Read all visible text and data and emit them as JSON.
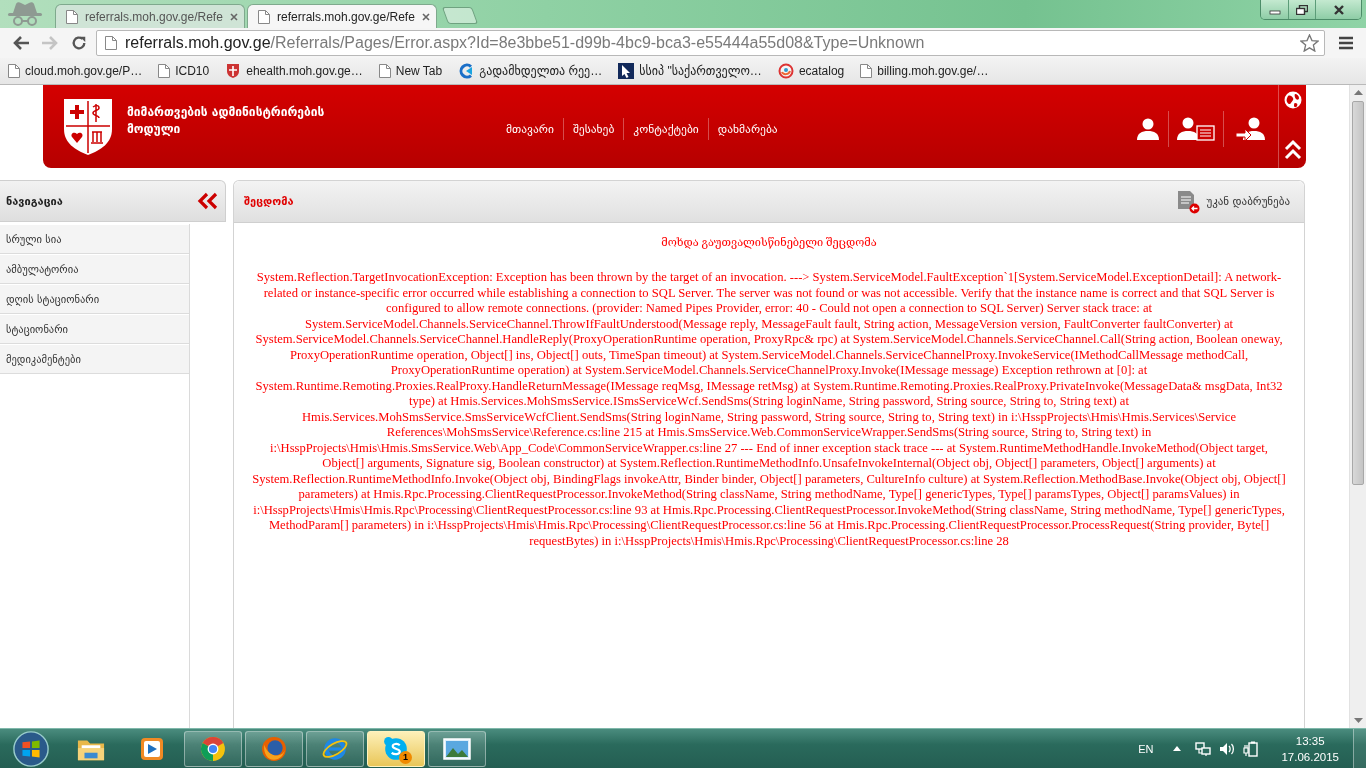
{
  "browser": {
    "tabs": [
      {
        "title": "referrals.moh.gov.ge/Refe",
        "selected": false
      },
      {
        "title": "referrals.moh.gov.ge/Refe",
        "selected": true
      }
    ],
    "back_enabled": true,
    "forward_enabled": false,
    "address": {
      "host": "referrals.moh.gov.ge",
      "path": "/Referrals/Pages/Error.aspx?Id=8e3bbe51-d99b-4bc9-bca3-e55444a55d08&Type=Unknown"
    },
    "bookmarks": [
      {
        "label": "cloud.moh.gov.ge/P…",
        "kind": "page"
      },
      {
        "label": "ICD10",
        "kind": "page"
      },
      {
        "label": "ehealth.moh.gov.ge…",
        "kind": "emblem"
      },
      {
        "label": "New Tab",
        "kind": "page"
      },
      {
        "label": "გადამხდელთა რეე…",
        "kind": "ring"
      },
      {
        "label": "სსიპ \"საქართველო…",
        "kind": "cursor"
      },
      {
        "label": "ecatalog",
        "kind": "swirl"
      },
      {
        "label": "billing.moh.gov.ge/…",
        "kind": "page"
      }
    ]
  },
  "header": {
    "title": "მიმართვების ადმინისტრირების მოდული",
    "nav": [
      "მთავარი",
      "შესახებ",
      "კონტაქტები",
      "დახმარება"
    ]
  },
  "sidebar": {
    "title": "ნავიგაცია",
    "items": [
      "სრული სია",
      "ამბულატორია",
      "დღის სტაციონარი",
      "სტაციონარი",
      "მედიკამენტები"
    ]
  },
  "panel": {
    "title": "შეცდომა",
    "back_button": "უკან დაბრუნება",
    "message": "მოხდა გაუთვალისწინებელი შეცდომა",
    "error_details": "System.Reflection.TargetInvocationException: Exception has been thrown by the target of an invocation. ---> System.ServiceModel.FaultException`1[System.ServiceModel.ExceptionDetail]: A network-related or instance-specific error occurred while establishing a connection to SQL Server. The server was not found or was not accessible. Verify that the instance name is correct and that SQL Server is configured to allow remote connections. (provider: Named Pipes Provider, error: 40 - Could not open a connection to SQL Server) Server stack trace: at System.ServiceModel.Channels.ServiceChannel.ThrowIfFaultUnderstood(Message reply, MessageFault fault, String action, MessageVersion version, FaultConverter faultConverter) at System.ServiceModel.Channels.ServiceChannel.HandleReply(ProxyOperationRuntime operation, ProxyRpc& rpc) at System.ServiceModel.Channels.ServiceChannel.Call(String action, Boolean oneway, ProxyOperationRuntime operation, Object[] ins, Object[] outs, TimeSpan timeout) at System.ServiceModel.Channels.ServiceChannelProxy.InvokeService(IMethodCallMessage methodCall, ProxyOperationRuntime operation) at System.ServiceModel.Channels.ServiceChannelProxy.Invoke(IMessage message) Exception rethrown at [0]: at System.Runtime.Remoting.Proxies.RealProxy.HandleReturnMessage(IMessage reqMsg, IMessage retMsg) at System.Runtime.Remoting.Proxies.RealProxy.PrivateInvoke(MessageData& msgData, Int32 type) at Hmis.Services.MohSmsService.ISmsServiceWcf.SendSms(String loginName, String password, String source, String to, String text) at Hmis.Services.MohSmsService.SmsServiceWcfClient.SendSms(String loginName, String password, String source, String to, String text) in i:\\HsspProjects\\Hmis\\Hmis.Services\\Service References\\MohSmsService\\Reference.cs:line 215 at Hmis.SmsService.Web.CommonServiceWrapper.SendSms(String source, String to, String text) in i:\\HsspProjects\\Hmis\\Hmis.SmsService.Web\\App_Code\\CommonServiceWrapper.cs:line 27 --- End of inner exception stack trace --- at System.RuntimeMethodHandle.InvokeMethod(Object target, Object[] arguments, Signature sig, Boolean constructor) at System.Reflection.RuntimeMethodInfo.UnsafeInvokeInternal(Object obj, Object[] parameters, Object[] arguments) at System.Reflection.RuntimeMethodInfo.Invoke(Object obj, BindingFlags invokeAttr, Binder binder, Object[] parameters, CultureInfo culture) at System.Reflection.MethodBase.Invoke(Object obj, Object[] parameters) at Hmis.Rpc.Processing.ClientRequestProcessor.InvokeMethod(String className, String methodName, Type[] genericTypes, Type[] paramsTypes, Object[] paramsValues) in i:\\HsspProjects\\Hmis\\Hmis.Rpc\\Processing\\ClientRequestProcessor.cs:line 93 at Hmis.Rpc.Processing.ClientRequestProcessor.InvokeMethod(String className, String methodName, Type[] genericTypes, MethodParam[] parameters) in i:\\HsspProjects\\Hmis\\Hmis.Rpc\\Processing\\ClientRequestProcessor.cs:line 56 at Hmis.Rpc.Processing.ClientRequestProcessor.ProcessRequest(String provider, Byte[] requestBytes) in i:\\HsspProjects\\Hmis\\Hmis.Rpc\\Processing\\ClientRequestProcessor.cs:line 28"
  },
  "taskbar": {
    "apps": [
      {
        "kind": "folder",
        "running": false,
        "flashing": false
      },
      {
        "kind": "media",
        "running": false,
        "flashing": false
      },
      {
        "kind": "chrome",
        "running": true,
        "flashing": false
      },
      {
        "kind": "firefox",
        "running": true,
        "flashing": false
      },
      {
        "kind": "ie",
        "running": true,
        "flashing": false
      },
      {
        "kind": "skype",
        "running": true,
        "flashing": true,
        "badge": "1"
      },
      {
        "kind": "photos",
        "running": true,
        "flashing": false
      }
    ],
    "language": "EN",
    "time": "13:35",
    "date": "17.06.2015"
  }
}
